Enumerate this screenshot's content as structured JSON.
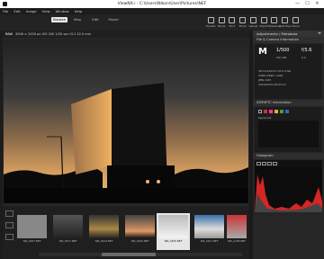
{
  "window": {
    "title": "ViewNX-i - C:\\Users\\Nikon\\User\\Pictures\\NEF",
    "minimize": "—",
    "maximize": "☐",
    "close": "✕"
  },
  "menu": [
    "File",
    "Edit",
    "Image",
    "View",
    "Window",
    "Help"
  ],
  "modes": [
    "Browse",
    "Map",
    "Edit",
    "Movie"
  ],
  "active_mode": "Browse",
  "toolbar_icons": [
    "Transfer",
    "Movie",
    "Print",
    "Email",
    "Upload",
    "Export",
    "Slideshow",
    "Auto Play",
    "Share"
  ],
  "viewer_toolbar": {
    "sort": "Sort: ABC",
    "filter": "Filter"
  },
  "image_info": {
    "name": "RAW",
    "details": "3008 × 2000 px  ISO 200  1/30 sec  f/11  42.0 mm"
  },
  "filmstrip": [
    {
      "label": "NIK_0007.NEF",
      "color": "#888"
    },
    {
      "label": "NIK_0017.NEF",
      "color": "#444"
    },
    {
      "label": "NIK_0019.NEF",
      "color": "#a84"
    },
    {
      "label": "NIK_0020.NEF",
      "color": "#d96"
    },
    {
      "label": "NIK_0106.NEF",
      "color": "#e8e8e8"
    },
    {
      "label": "NIK_0107.NEF",
      "color": "#3b6ea8"
    },
    {
      "label": "NIK_0108.NEF",
      "color": "#c33"
    }
  ],
  "panel": {
    "title": "Adjustments / Metadata",
    "file_camera": "File & Camera Information",
    "mode": "M",
    "shutter": "1/500",
    "aperture": "f/5.6",
    "iso": "ISO 200",
    "ev": "0.0",
    "lens": "VR 18-105mm f/3.5-5.6G",
    "info1": "4288×2848 / 14bit",
    "info2": "JPEG 12M",
    "info3": "2012/05/23 00:05:14",
    "iptc": "XMP/IPTC Information",
    "keywords": "Keywords",
    "histogram": "Histogram"
  },
  "colors": {
    "accent": "#e6e6e6",
    "panel_bg": "#262626",
    "histogram_red": "#d32626"
  }
}
